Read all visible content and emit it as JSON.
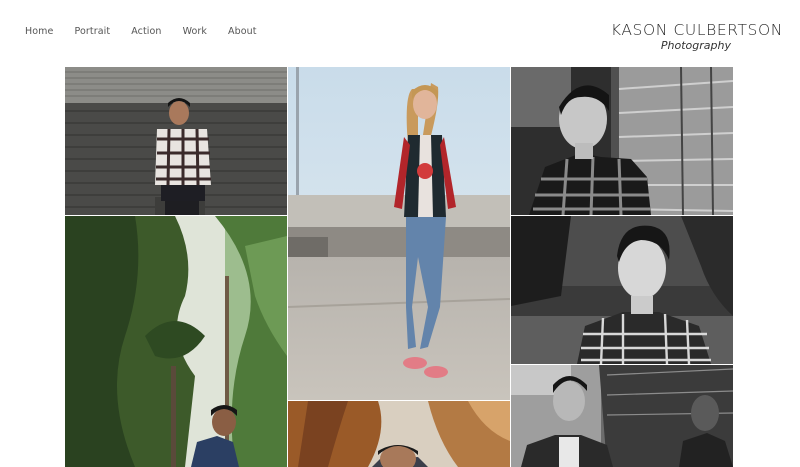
{
  "nav": {
    "items": [
      {
        "label": "Home"
      },
      {
        "label": "Portrait"
      },
      {
        "label": "Action"
      },
      {
        "label": "Work"
      },
      {
        "label": "About"
      }
    ]
  },
  "brand": {
    "name": "KASON CULBERTSON",
    "tagline": "Photography"
  },
  "gallery": {
    "photos": [
      {
        "subject": "young man in plaid shirt against grey wooden wall",
        "tone": "color"
      },
      {
        "subject": "young woman in plaid shirt and ripped jeans on parking lot",
        "tone": "color"
      },
      {
        "subject": "smiling young man in plaid shirt beside siding",
        "tone": "black-and-white"
      },
      {
        "subject": "young man among tall evergreen trees",
        "tone": "color"
      },
      {
        "subject": "young man in plaid shirt, forest background",
        "tone": "black-and-white"
      },
      {
        "subject": "portrait with autumn foliage",
        "tone": "color"
      },
      {
        "subject": "young man in denim jacket with reflection",
        "tone": "black-and-white"
      }
    ]
  }
}
